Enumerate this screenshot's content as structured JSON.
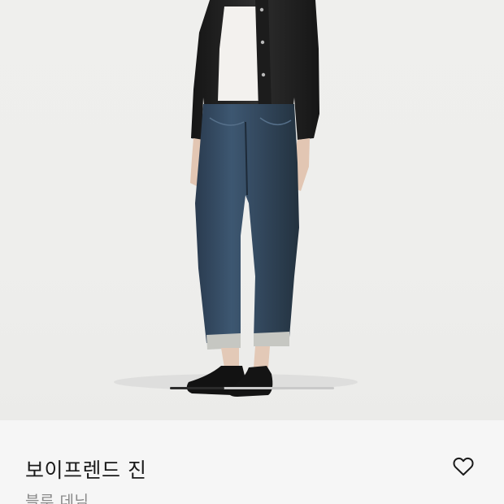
{
  "product": {
    "name": "보이프렌드 진",
    "color": "블루 데님"
  },
  "carousel": {
    "progress": 0.33
  },
  "icons": {
    "wishlist": "heart-outline-icon"
  },
  "colors": {
    "background": "#eeeeec",
    "info_panel": "#f6f6f6",
    "text_primary": "#1a1a1a",
    "text_secondary": "#8a8a8a"
  }
}
